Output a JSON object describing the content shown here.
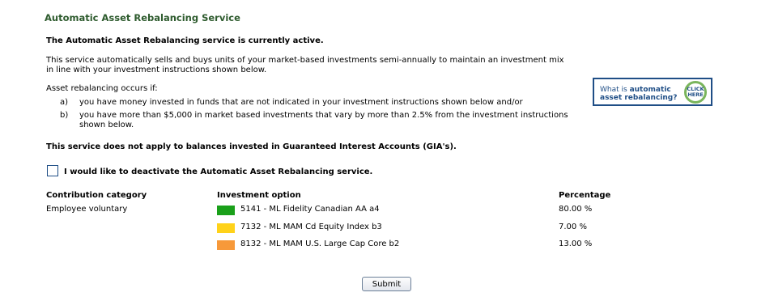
{
  "page": {
    "title": "Automatic Asset Rebalancing Service",
    "status_text": "The Automatic Asset Rebalancing service is currently active.",
    "description": "This service automatically sells and buys units of your market-based investments semi-annually to maintain an investment mix in line with your investment instructions shown below.",
    "occurs_intro": "Asset rebalancing occurs if:",
    "conditions": [
      {
        "marker": "a)",
        "text": "you have money invested in funds that are not indicated in your investment instructions shown below and/or"
      },
      {
        "marker": "b)",
        "text": "you have more than $5,000 in market based investments that vary by more than 2.5% from the investment instructions shown below."
      }
    ],
    "gia_notice": "This service does not apply to balances invested in Guaranteed Interest Accounts (GIA's)."
  },
  "promo": {
    "line1_prefix": "What is ",
    "line1_bold": "automatic",
    "line2": "asset rebalancing?",
    "click_line1": "CLICK",
    "click_line2": "HERE",
    "border_color": "#1f4e86",
    "ring_color": "#7ab55c"
  },
  "deactivate": {
    "checked": false,
    "label": "I would like to deactivate the Automatic Asset Rebalancing service."
  },
  "table": {
    "headers": {
      "category": "Contribution category",
      "option": "Investment option",
      "percentage": "Percentage"
    },
    "category_value": "Employee voluntary",
    "rows": [
      {
        "color": "#1aa01a",
        "option": "5141 - ML Fidelity Canadian AA a4",
        "percentage": "80.00 %"
      },
      {
        "color": "#ffd21a",
        "option": "7132 - ML MAM Cd Equity Index b3",
        "percentage": "7.00 %"
      },
      {
        "color": "#f7993a",
        "option": "8132 - ML MAM U.S. Large Cap Core b2",
        "percentage": "13.00 %"
      }
    ]
  },
  "submit_label": "Submit"
}
